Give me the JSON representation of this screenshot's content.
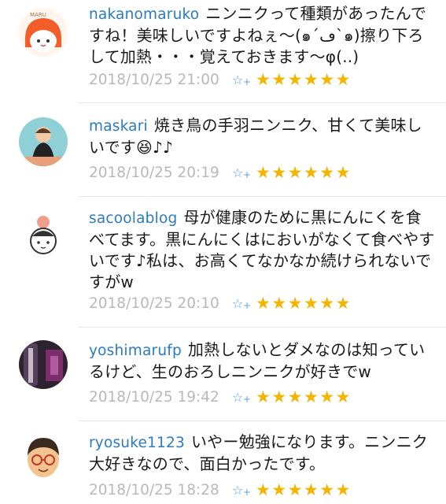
{
  "comments": [
    {
      "user": "nakanomaruko",
      "text": "ニンニクって種類があったんですね！美味しいですよねぇ～(๑´ڡ`๑)擦り下ろして加熱・・・覚えておきます～φ(..)",
      "date": "2018/10/25 21:00",
      "stars": "★★★★★★",
      "avatar_label": "MARU",
      "avatar_color": "#f25d2a"
    },
    {
      "user": "maskari",
      "text": "焼き鳥の手羽ニンニク、甘くて美味しいです😆♪♪",
      "date": "2018/10/25 20:19",
      "stars": "★★★★★★",
      "avatar_color": "#7ec4c9"
    },
    {
      "user": "sacoolablog",
      "text": "母が健康のために黒にんにくを食べてます。黒にんにくはにおいがなくて食べやすいです♪私は、お高くてなかなか続けられないですがw",
      "date": "2018/10/25 20:10",
      "stars": "★★★★★★",
      "avatar_color": "#f0a08a"
    },
    {
      "user": "yoshimarufp",
      "text": "加熱しないとダメなのは知っているけど、生のおろしニンニクが好きでw",
      "date": "2018/10/25 19:42",
      "stars": "★★★★★★",
      "avatar_color": "#3a2a3a"
    },
    {
      "user": "ryosuke1123",
      "text": "いやー勉強になります。ニンニク大好きなので、面白かったです。",
      "date": "2018/10/25 18:28",
      "stars": "★★★★★★",
      "avatar_color": "#f3c48f"
    }
  ],
  "icons": {
    "add_star": "star-outline-icon",
    "stars": "star-icon"
  },
  "colors": {
    "username": "#2a7bbf",
    "date": "#b9b9b9",
    "star": "#f4b400",
    "add_star": "#5aa2e0"
  }
}
